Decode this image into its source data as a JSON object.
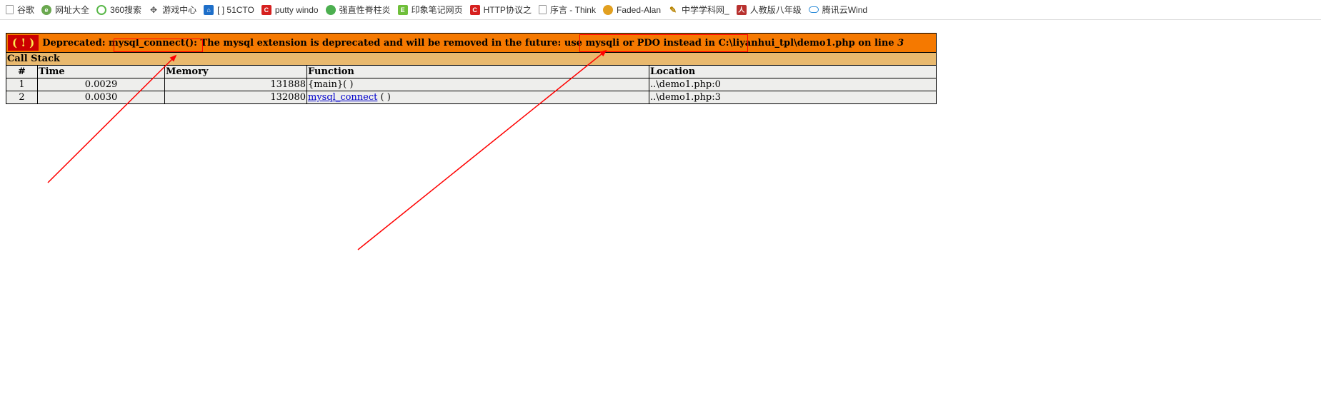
{
  "bookmarks": [
    {
      "label": "谷歌",
      "icon": "page-icon"
    },
    {
      "label": "网址大全",
      "icon": "globe-icon"
    },
    {
      "label": "360搜索",
      "icon": "360-icon"
    },
    {
      "label": "游戏中心",
      "icon": "gamepad-icon"
    },
    {
      "label": "[ ] 51CTO",
      "icon": "house-icon"
    },
    {
      "label": "putty windo",
      "icon": "c-logo-icon"
    },
    {
      "label": "强直性脊柱炎",
      "icon": "green-leaf-icon"
    },
    {
      "label": "印象笔记网页",
      "icon": "evernote-icon"
    },
    {
      "label": "HTTP协议之",
      "icon": "c-logo-icon"
    },
    {
      "label": "序言 - Think",
      "icon": "page-icon"
    },
    {
      "label": "Faded-Alan",
      "icon": "faded-icon"
    },
    {
      "label": "中学学科网_",
      "icon": "education-icon"
    },
    {
      "label": "人教版八年级",
      "icon": "pep-icon"
    },
    {
      "label": "腾讯云Wind",
      "icon": "cloud-icon"
    }
  ],
  "error": {
    "icon_text": "( ! )",
    "prefix": "Deprecated: ",
    "function_name": "mysql_connect():",
    "middle": " The mysql extension is deprecated and will be removed in the future: ",
    "suggestion": "use mysqli or PDO instead",
    "location_text": " in C:\\liyanhui_tpl\\demo1.php on line ",
    "line": "3"
  },
  "call_stack": {
    "title": "Call Stack",
    "headers": [
      "#",
      "Time",
      "Memory",
      "Function",
      "Location"
    ],
    "rows": [
      {
        "index": "1",
        "time": "0.0029",
        "memory": "131888",
        "function": "{main}",
        "suffix": "( )",
        "location": "..\\demo1.php:0"
      },
      {
        "index": "2",
        "time": "0.0030",
        "memory": "132080",
        "function": "mysql_connect",
        "suffix": " ( )",
        "location": "..\\demo1.php:3"
      }
    ]
  },
  "colors": {
    "error_header": "#f57900",
    "call_stack_header": "#e9b96e",
    "cell_bg": "#eeeeec",
    "annotation_red": "#ff0000"
  }
}
